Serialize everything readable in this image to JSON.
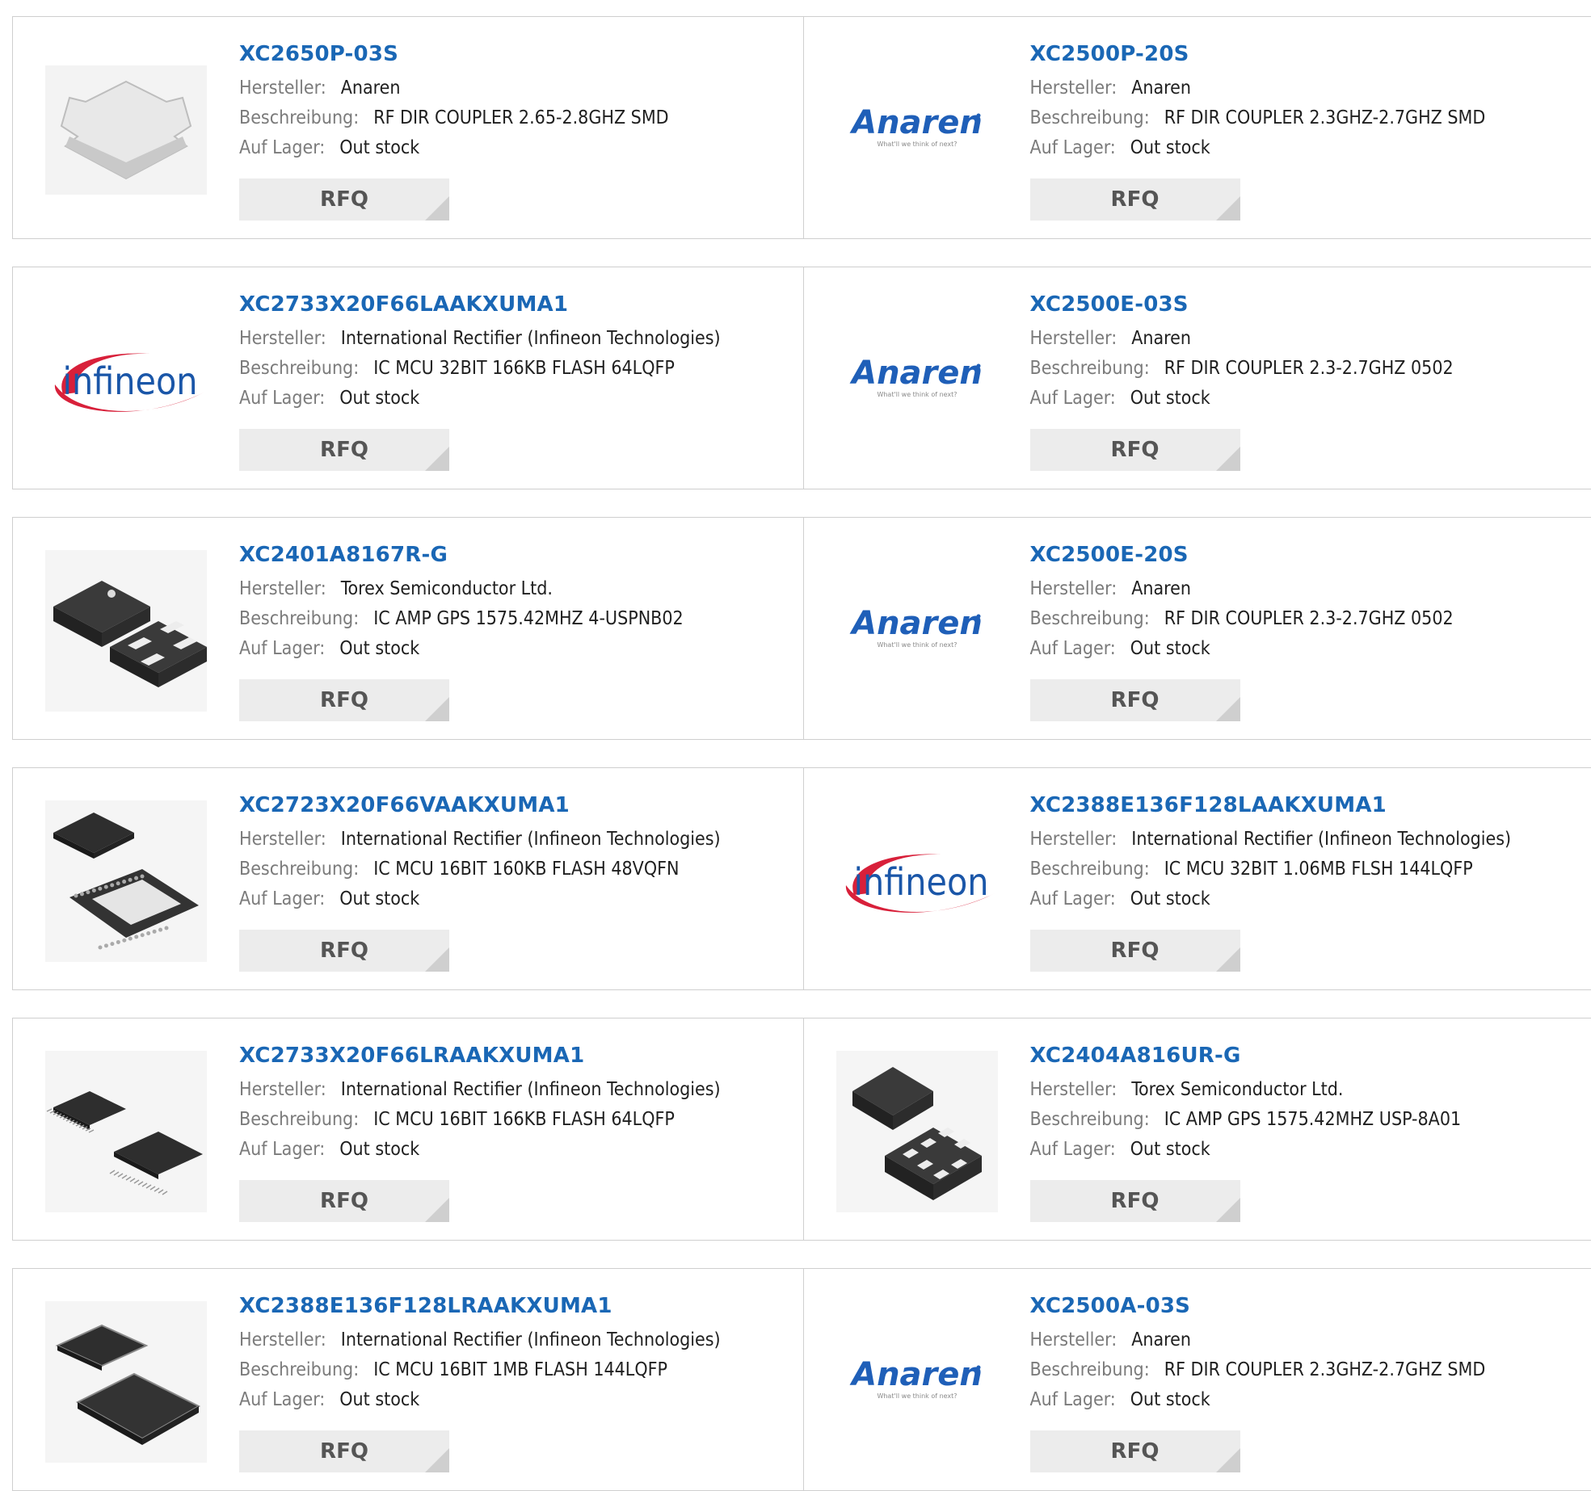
{
  "labels": {
    "manufacturer": "Hersteller:",
    "description": "Beschreibung:",
    "stock": "Auf Lager:",
    "rfq": "RFQ"
  },
  "logos": {
    "anaren": {
      "name": "Anaren",
      "tagline": "What'll we think of next?"
    },
    "infineon": {
      "name": "infineon"
    }
  },
  "colors": {
    "part_link": "#1a67b5",
    "anaren_blue": "#1f5fb8",
    "infineon_red": "#d8203a",
    "infineon_blue": "#1a56a8"
  },
  "products": [
    {
      "part": "XC2650P-03S",
      "manufacturer": "Anaren",
      "description": "RF DIR COUPLER 2.65-2.8GHZ SMD",
      "stock": "Out stock",
      "image": "coupler-chip"
    },
    {
      "part": "XC2500P-20S",
      "manufacturer": "Anaren",
      "description": "RF DIR COUPLER 2.3GHZ-2.7GHZ SMD",
      "stock": "Out stock",
      "image": "anaren-logo"
    },
    {
      "part": "XC2733X20F66LAAKXUMA1",
      "manufacturer": "International Rectifier (Infineon Technologies)",
      "description": "IC MCU 32BIT 166KB FLASH 64LQFP",
      "stock": "Out stock",
      "image": "infineon-logo"
    },
    {
      "part": "XC2500E-03S",
      "manufacturer": "Anaren",
      "description": "RF DIR COUPLER 2.3-2.7GHZ 0502",
      "stock": "Out stock",
      "image": "anaren-logo"
    },
    {
      "part": "XC2401A8167R-G",
      "manufacturer": "Torex Semiconductor Ltd.",
      "description": "IC AMP GPS 1575.42MHZ 4-USPNB02",
      "stock": "Out stock",
      "image": "usp4-chip"
    },
    {
      "part": "XC2500E-20S",
      "manufacturer": "Anaren",
      "description": "RF DIR COUPLER 2.3-2.7GHZ 0502",
      "stock": "Out stock",
      "image": "anaren-logo"
    },
    {
      "part": "XC2723X20F66VAAKXUMA1",
      "manufacturer": "International Rectifier (Infineon Technologies)",
      "description": "IC MCU 16BIT 160KB FLASH 48VQFN",
      "stock": "Out stock",
      "image": "vqfn-chip"
    },
    {
      "part": "XC2388E136F128LAAKXUMA1",
      "manufacturer": "International Rectifier (Infineon Technologies)",
      "description": "IC MCU 32BIT 1.06MB FLSH 144LQFP",
      "stock": "Out stock",
      "image": "infineon-logo"
    },
    {
      "part": "XC2733X20F66LRAAKXUMA1",
      "manufacturer": "International Rectifier (Infineon Technologies)",
      "description": "IC MCU 16BIT 166KB FLASH 64LQFP",
      "stock": "Out stock",
      "image": "lqfp-chip"
    },
    {
      "part": "XC2404A816UR-G",
      "manufacturer": "Torex Semiconductor Ltd.",
      "description": "IC AMP GPS 1575.42MHZ USP-8A01",
      "stock": "Out stock",
      "image": "usp8-chip"
    },
    {
      "part": "XC2388E136F128LRAAKXUMA1",
      "manufacturer": "International Rectifier (Infineon Technologies)",
      "description": "IC MCU 16BIT 1MB FLASH 144LQFP",
      "stock": "Out stock",
      "image": "lqfp144-chip"
    },
    {
      "part": "XC2500A-03S",
      "manufacturer": "Anaren",
      "description": "RF DIR COUPLER 2.3GHZ-2.7GHZ SMD",
      "stock": "Out stock",
      "image": "anaren-logo"
    }
  ]
}
